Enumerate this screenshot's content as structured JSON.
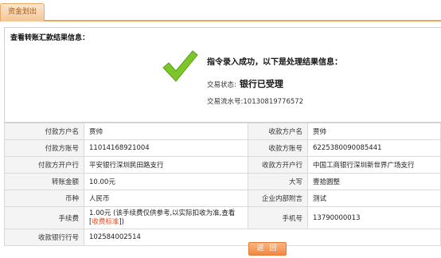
{
  "tab": {
    "label": "资金划出"
  },
  "panel": {
    "title": "查看转账汇款结果信息："
  },
  "result": {
    "message": "指令录入成功，以下是处理结果信息：",
    "status_label": "交易状态:",
    "status_value": "银行已受理",
    "serial_label": "交易流水号:",
    "serial_value": "10130819776572"
  },
  "details": {
    "payer_name_label": "付款方户名",
    "payer_name": "贾帅",
    "payee_name_label": "收款方户名",
    "payee_name": "贾帅",
    "payer_account_label": "付款方账号",
    "payer_account": "11014168921004",
    "payee_account_label": "收款方账号",
    "payee_account": "6225380090085441",
    "payer_bank_label": "付款方开户行",
    "payer_bank": "平安银行深圳民田路支行",
    "payee_bank_label": "收款方开户行",
    "payee_bank": "中国工商银行深圳新世界广场支行",
    "amount_label": "转账金额",
    "amount": "10.00元",
    "amount_upper_label": "大写",
    "amount_upper": "壹拾圆整",
    "currency_label": "币种",
    "currency": "人民币",
    "memo_label": "企业内部附言",
    "memo": "测试",
    "fee_label": "手续费",
    "fee_text": "1.00元 (该手续费仅供参考,以实际扣收为准,查看[",
    "fee_link": "收费标准",
    "fee_text_end": "])",
    "phone_label": "手机号",
    "phone": "13790000013",
    "payee_bank_no_label": "收款银行行号",
    "payee_bank_no": "102584002514"
  },
  "buttons": {
    "back": "返 回"
  },
  "colors": {
    "accent": "#f0a35a",
    "check": "#7cc62a",
    "button": "#ef8742"
  }
}
